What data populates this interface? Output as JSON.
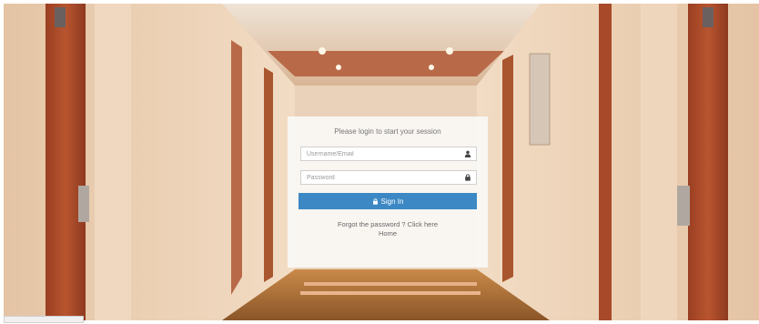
{
  "login": {
    "message": "Please login to start your session",
    "username_placeholder": "Username/Email",
    "password_placeholder": "Password",
    "signin_label": "Sign In",
    "forgot_label": "Forgot the password ? Click here",
    "home_label": "Home"
  },
  "icons": {
    "username": "user-icon",
    "password": "lock-icon",
    "signin": "lock-icon"
  },
  "colors": {
    "accent": "#3b88c4",
    "door": "#a9472a",
    "wall": "#e6c9aa"
  }
}
